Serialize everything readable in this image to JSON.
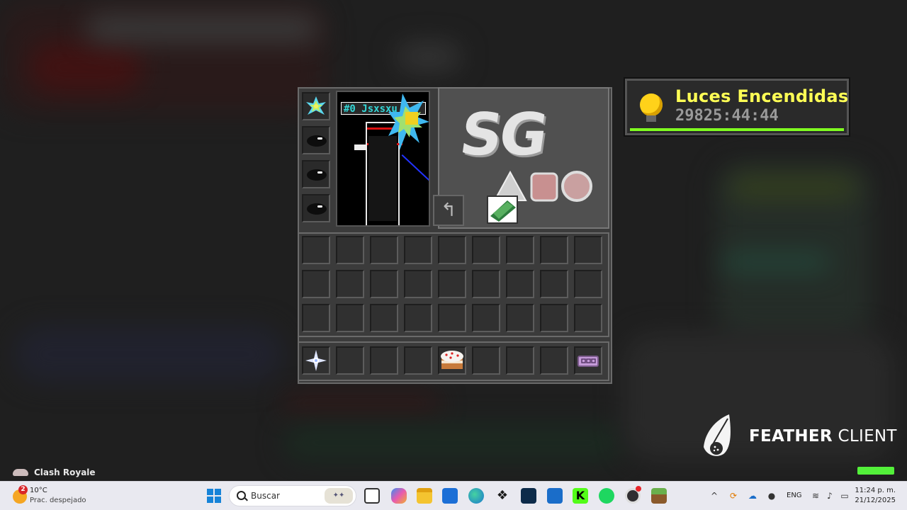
{
  "inventory": {
    "player": {
      "nametag": "#0 Jsxsxu"
    },
    "armor_slots": [
      "black-egg",
      "black-egg",
      "black-egg"
    ],
    "main_slots_count": 27,
    "hotbar": [
      {
        "slot": 1,
        "item": "nether-star"
      },
      {
        "slot": 5,
        "item": "cake"
      },
      {
        "slot": 9,
        "item": "name-tag"
      }
    ],
    "logo_text": "SG"
  },
  "toast": {
    "title": "Luces Encendidas",
    "subtitle": "29825:44:44",
    "icon": "lightbulb-icon",
    "title_color": "#ffff55",
    "bar_color": "#80ff20"
  },
  "branding": {
    "name_bold": "FEATHER",
    "name_light": " CLIENT",
    "accent": "#53f03a"
  },
  "notification": {
    "app": "Clash Royale"
  },
  "taskbar": {
    "weather": {
      "badge": "2",
      "temp": "10°C",
      "desc": "Prac. despejado"
    },
    "search_placeholder": "Buscar",
    "language": "ENG",
    "time": "11:24 p. m.",
    "date": "21/12/2025",
    "pinned": [
      "task-view-icon",
      "copilot-icon",
      "file-explorer-icon",
      "store-icon",
      "edge-icon",
      "dropbox-icon",
      "app-icon",
      "outlook-icon",
      "kick-icon",
      "spotify-icon",
      "obs-icon",
      "minecraft-icon"
    ]
  }
}
